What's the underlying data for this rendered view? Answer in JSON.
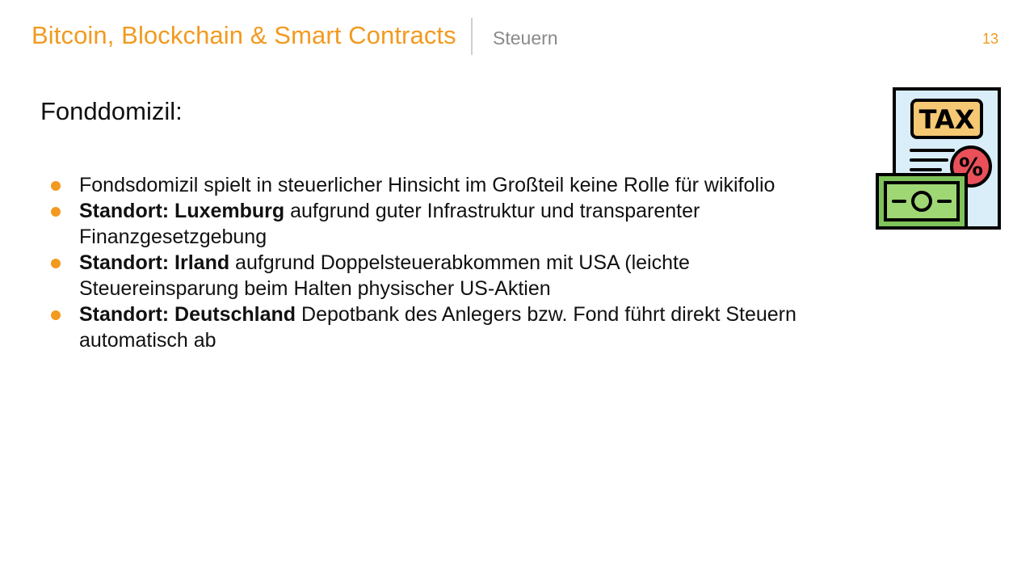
{
  "header": {
    "title": "Bitcoin, Blockchain & Smart Contracts",
    "section": "Steuern",
    "page_number": "13"
  },
  "slide": {
    "heading": "Fonddomizil:",
    "bullets": [
      {
        "strong": "",
        "text": "Fondsdomizil spielt in steuerlicher Hinsicht im Großteil keine Rolle für wikifolio"
      },
      {
        "strong": "Standort: Luxemburg",
        "text": " aufgrund guter Infrastruktur und  transparenter Finanzgesetzgebung"
      },
      {
        "strong": "Standort: Irland",
        "text": " aufgrund Doppelsteuerabkommen mit USA (leichte Steuereinsparung beim Halten physischer US-Aktien"
      },
      {
        "strong": "Standort: Deutschland",
        "text": " Depotbank des Anlegers bzw. Fond führt direkt Steuern automatisch ab"
      }
    ]
  },
  "illustration": {
    "icon": "tax-document-icon",
    "label": "TAX",
    "percent_symbol": "%"
  },
  "colors": {
    "accent": "#f29a1f",
    "muted": "#8a8a8a",
    "text": "#111111"
  }
}
